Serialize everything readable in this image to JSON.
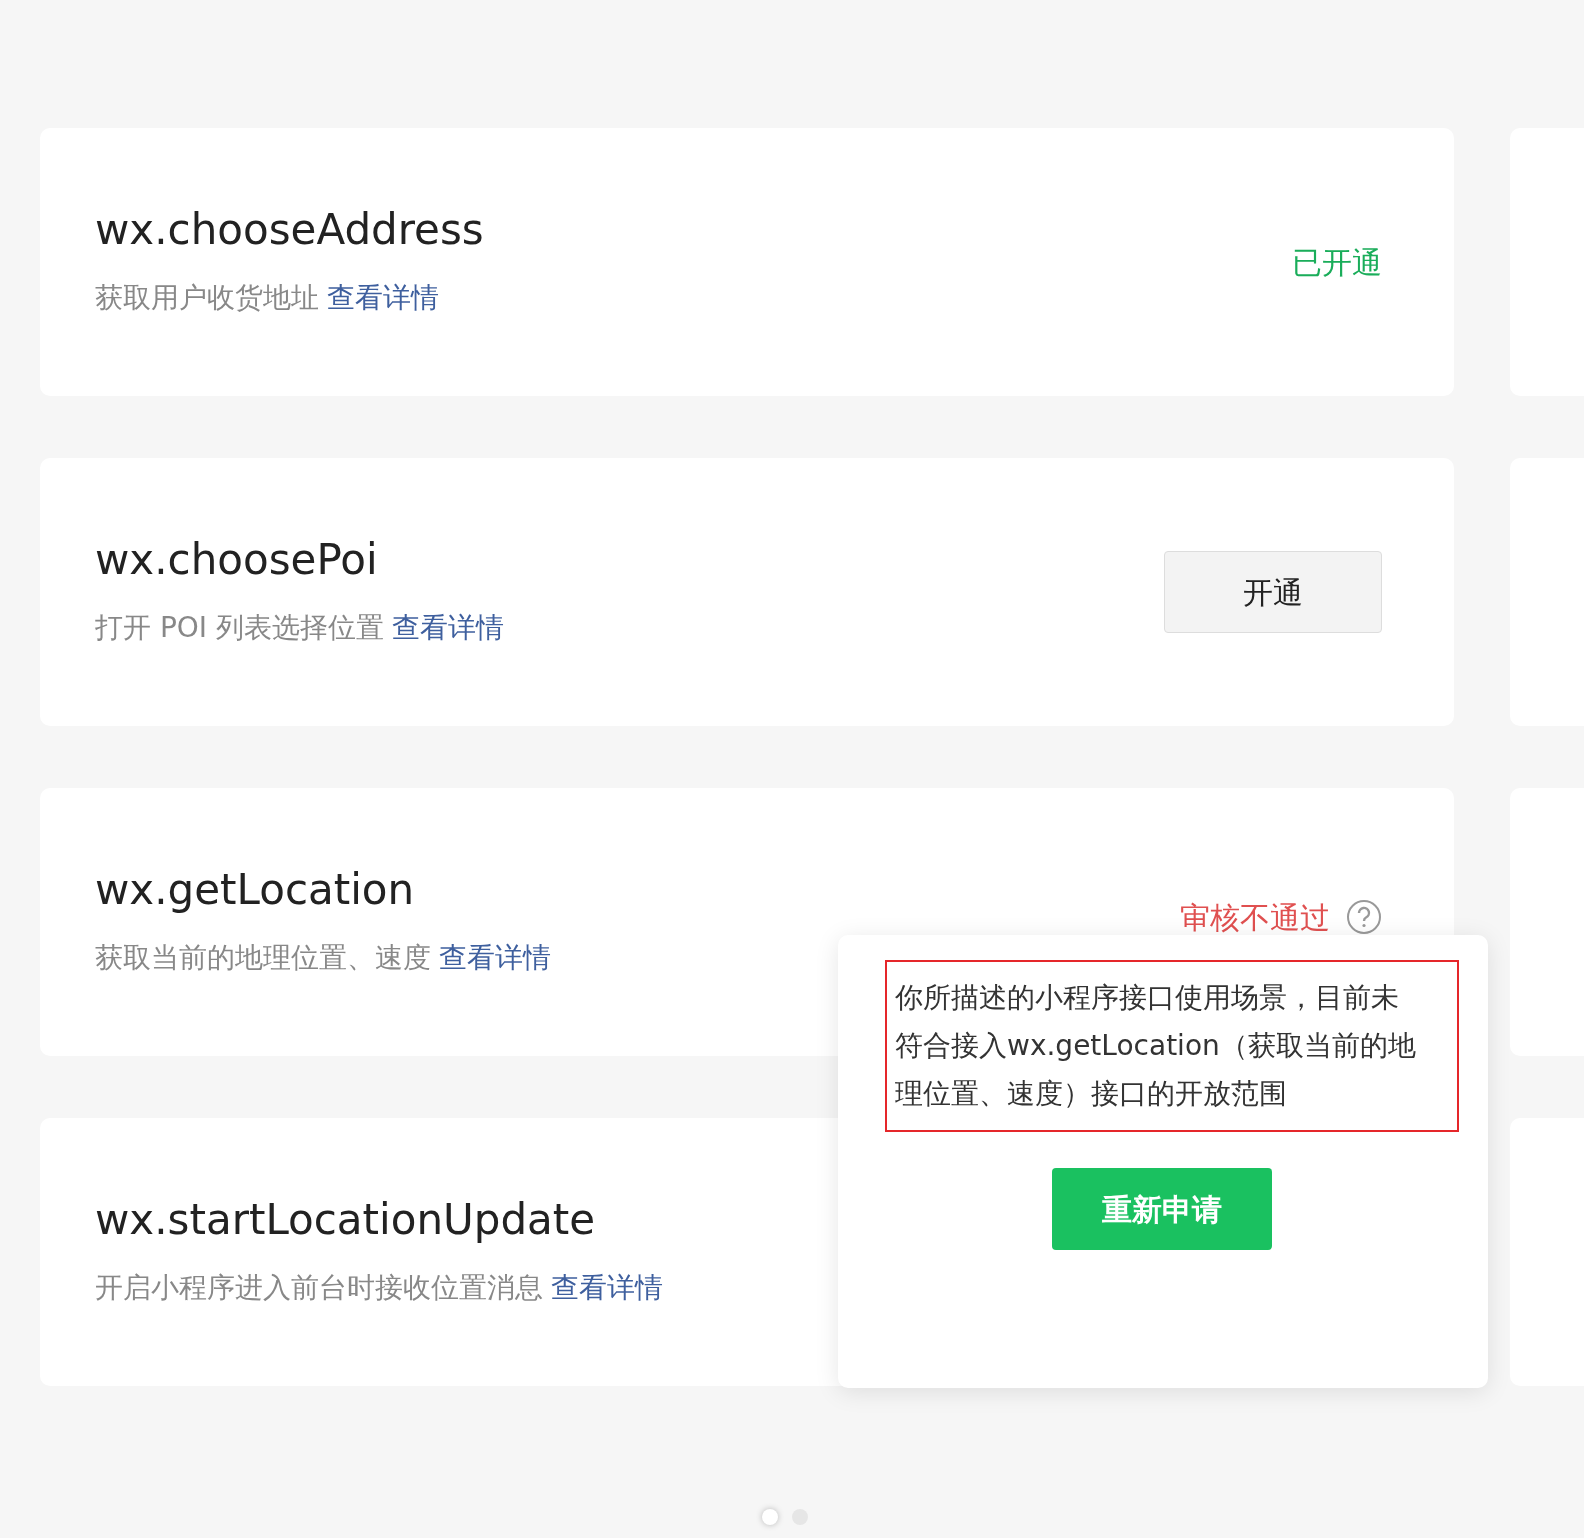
{
  "cards": [
    {
      "title": "wx.chooseAddress",
      "description": "获取用户收货地址",
      "link": "查看详情",
      "status": {
        "kind": "enabled",
        "label": "已开通"
      }
    },
    {
      "title": "wx.choosePoi",
      "description": "打开 POI 列表选择位置",
      "link": "查看详情",
      "status": {
        "kind": "button",
        "label": "开通"
      }
    },
    {
      "title": "wx.getLocation",
      "description": "获取当前的地理位置、速度",
      "link": "查看详情",
      "status": {
        "kind": "rejected",
        "label": "审核不通过"
      }
    },
    {
      "title": "wx.startLocationUpdate",
      "description": "开启小程序进入前台时接收位置消息",
      "link": "查看详情"
    }
  ],
  "popover": {
    "message": "你所描述的小程序接口使用场景，目前未符合接入wx.getLocation（获取当前的地理位置、速度）接口的开放范围",
    "highlighted": true,
    "button": "重新申请"
  },
  "pager": [
    {
      "selected": true
    },
    {
      "selected": false
    }
  ]
}
